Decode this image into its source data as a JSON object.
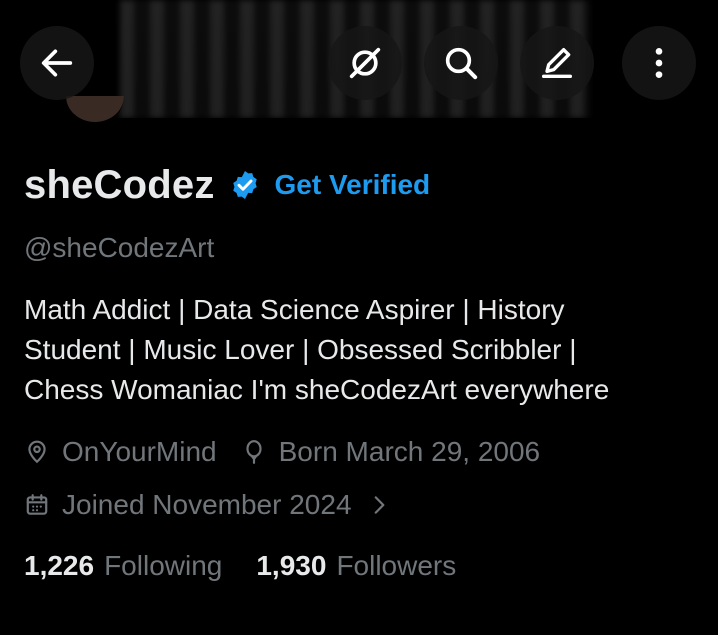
{
  "header": {
    "back_icon": "arrow-left-icon",
    "actions": [
      {
        "name": "grok-icon"
      },
      {
        "name": "search-icon"
      },
      {
        "name": "edit-icon"
      },
      {
        "name": "more-vertical-icon"
      }
    ]
  },
  "profile": {
    "display_name": "sheCodez",
    "verified_icon": "verified-badge-icon",
    "get_verified": "Get Verified",
    "handle": "@sheCodezArt",
    "bio": "Math Addict | Data Science Aspirer | History\nStudent | Music Lover |  Obsessed Scribbler |\nChess Womaniac  I'm sheCodezArt everywhere",
    "location": "OnYourMind",
    "birthday": "Born March 29, 2006",
    "joined": "Joined November 2024",
    "following_count": "1,226",
    "following_label": "Following",
    "followers_count": "1,930",
    "followers_label": "Followers"
  },
  "colors": {
    "background": "#000000",
    "text": "#e7e9ea",
    "muted": "#71767b",
    "accent": "#1d9bf0"
  }
}
